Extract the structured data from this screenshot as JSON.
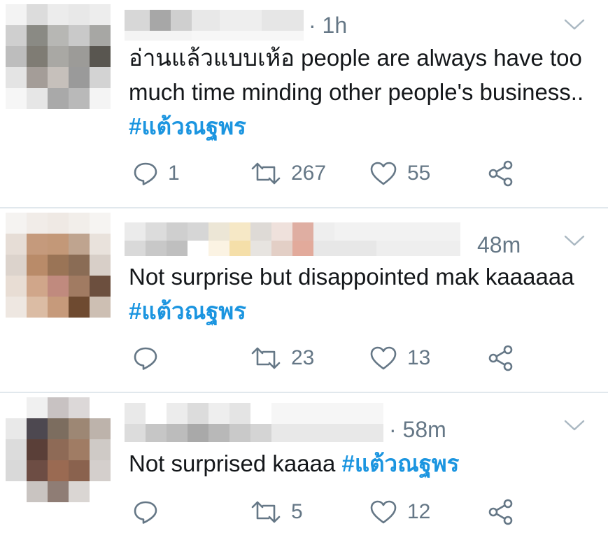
{
  "tweets": [
    {
      "time": "· 1h",
      "text_plain": "อ่านแล้วแบบเห้อ people are always have too much time minding other people's business.. ",
      "hashtag": "#แต้วณฐพร",
      "reply_count": "1",
      "retweet_count": "267",
      "like_count": "55",
      "avatar_colors": [
        "#f3f3f3",
        "#dcdcdc",
        "#ececec",
        "#e8e8e8",
        "#ededed",
        "#cfcfcf",
        "#8a8a84",
        "#b7b7b4",
        "#c9c9c9",
        "#a7a7a4",
        "#bdbdbd",
        "#7f7c74",
        "#a9a8a4",
        "#9c9b98",
        "#595650",
        "#e4e4e4",
        "#a49d98",
        "#c6c0bb",
        "#9a9a9a",
        "#d3d3d3",
        "#f6f6f6",
        "#e6e6e6",
        "#a9a9a9",
        "#b9b9b9",
        "#f4f4f4"
      ]
    },
    {
      "time": "48m",
      "text_plain": "Not surprise but disappointed mak kaaaaaa ",
      "hashtag": "#แต้วณฐพร",
      "reply_count": "",
      "retweet_count": "23",
      "like_count": "13",
      "avatar_colors": [
        "#f5f3f1",
        "#f1ece8",
        "#efe9e4",
        "#f2eeea",
        "#f6f4f2",
        "#e6ddd6",
        "#c59a7c",
        "#c39878",
        "#bfa48f",
        "#e9e2dc",
        "#dcd3cc",
        "#b98b69",
        "#9a7456",
        "#8a6c55",
        "#d8cfc8",
        "#e8ddd4",
        "#d0a68a",
        "#c08a7e",
        "#a17b62",
        "#6c4f3e",
        "#eee7e1",
        "#dbbca4",
        "#c69a7b",
        "#6e4a30",
        "#cdbfb3"
      ]
    },
    {
      "time": "· 58m",
      "text_plain": "Not surprised kaaaa ",
      "hashtag": "#แต้วณฐพร",
      "reply_count": "",
      "retweet_count": "5",
      "like_count": "12",
      "avatar_colors": [
        "#ffffff",
        "#f0f0f0",
        "#c8c2c2",
        "#dcd8d8",
        "#ffffff",
        "#e9e9e9",
        "#4d4850",
        "#7c6d5f",
        "#9d8774",
        "#bdb3ab",
        "#dcdcdc",
        "#5a3f38",
        "#8e6a56",
        "#a07c64",
        "#cfcac6",
        "#d9d9d9",
        "#6d4d44",
        "#9a6a52",
        "#8a624e",
        "#d4cfcc",
        "#ffffff",
        "#c9c4c1",
        "#8f7d75",
        "#dad6d3",
        "#ffffff"
      ]
    }
  ],
  "colors": {
    "text": "#14171a",
    "muted": "#657786",
    "hashtag": "#1b95e0",
    "divider": "#e1e8ed"
  },
  "icons": [
    "reply-icon",
    "retweet-icon",
    "like-icon",
    "share-icon",
    "chevron-down-icon"
  ]
}
